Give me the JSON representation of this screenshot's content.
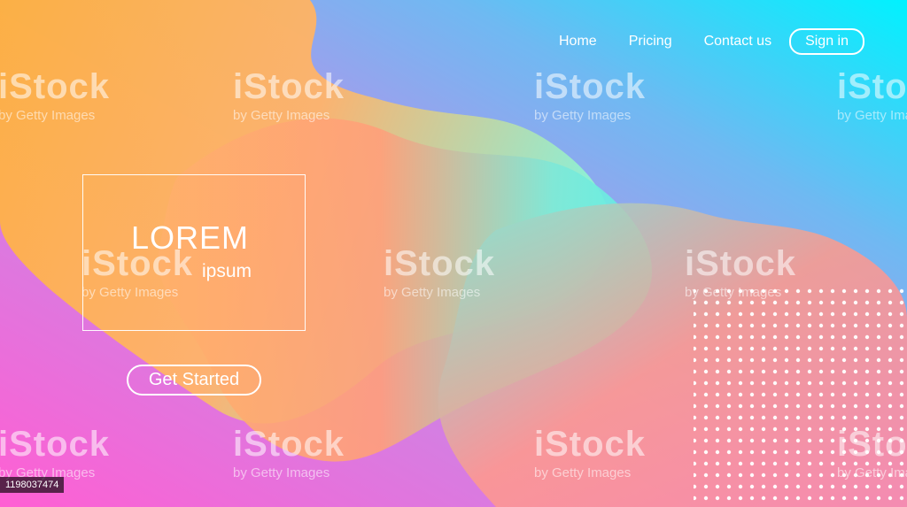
{
  "nav": {
    "home": "Home",
    "pricing": "Pricing",
    "contact": "Contact us",
    "signin": "Sign in"
  },
  "hero": {
    "title": "LOREM",
    "subtitle": "ipsum",
    "cta": "Get Started"
  },
  "watermark": {
    "brand": "iStock",
    "credit": "by Getty Images"
  },
  "image_id": "1198037474",
  "colors": {
    "pink": "#ff6ad5",
    "orange": "#ffb347",
    "mint": "#8ef0d5",
    "blue": "#5ec8ff",
    "cyan": "#00f0ff",
    "peach": "#ff9a8b"
  }
}
